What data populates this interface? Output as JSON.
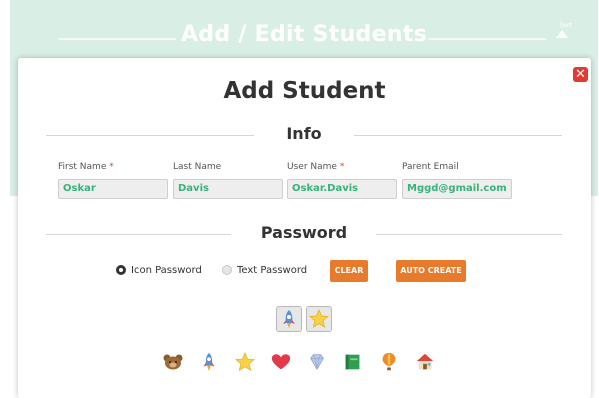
{
  "background": {
    "title": "Add / Edit Students",
    "arrow_label": "Sort"
  },
  "modal": {
    "title": "Add Student",
    "info_heading": "Info",
    "fields": [
      {
        "label": "First Name",
        "required": "*",
        "value": "Oskar"
      },
      {
        "label": "Last Name",
        "required": "",
        "value": "Davis"
      },
      {
        "label": "User Name",
        "required": "*",
        "value": "Oskar.Davis"
      },
      {
        "label": "Parent Email",
        "required": "",
        "value": "Mggd@gmail.com"
      }
    ],
    "password_heading": "Password",
    "password_options": [
      {
        "label": "Icon Password",
        "selected": true
      },
      {
        "label": "Text Password",
        "selected": false
      }
    ],
    "clear_label": "CLEAR",
    "auto_create_label": "AUTO CREATE",
    "selected_icons": [
      "rocket-icon",
      "star-icon"
    ],
    "icon_choices": [
      "bear-icon",
      "rocket-icon",
      "star-icon",
      "heart-icon",
      "diamond-icon",
      "book-icon",
      "balloon-icon",
      "house-icon"
    ]
  },
  "colors": {
    "accent_orange": "#e87a2c",
    "value_green": "#39b27b",
    "close_red": "#e23a33",
    "banner": "#d9efe5"
  }
}
